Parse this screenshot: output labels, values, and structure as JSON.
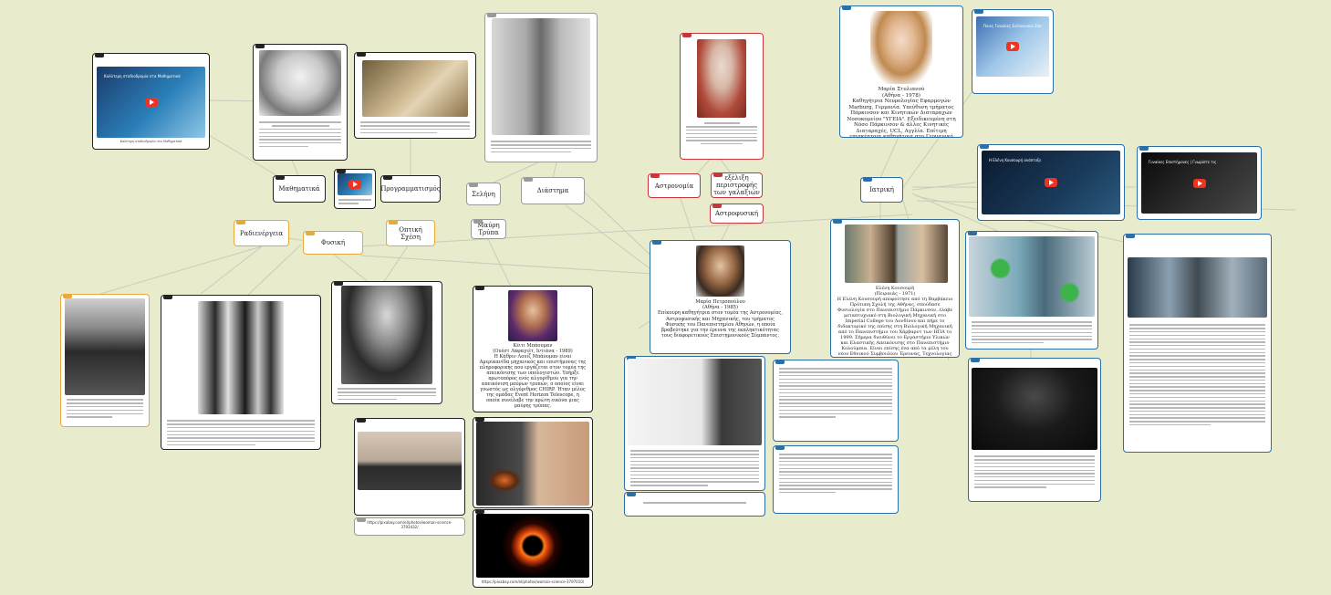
{
  "colors": {
    "background": "#e8ebcc",
    "black": "#222222",
    "blue": "#2a6fa8",
    "red": "#c7363c",
    "orange": "#e6a93a",
    "grey": "#9a9a9a",
    "link": "#c9ccbc"
  },
  "labels": {
    "mathimatika": "Μαθηματικά",
    "programmatismos": "Προγραμματισμός",
    "seliini": "Σελήνη",
    "diastima": "Διάστημα",
    "astronomia": "Αστρονομία",
    "galaxies": "εξέλιξη περιστροφής των γαλαξιών",
    "astrofysiki": "Αστροφυσική",
    "iatriki": "Ιατρική",
    "radienergeia": "Ραδιενέργεια",
    "fysiki": "Φυσική",
    "opt_sximi": "Οπτική Σχέση",
    "mavri_trypa": "Μαύρη Τρύπα"
  },
  "people": {
    "stylianou": {
      "name": "Μαρία Στυλιανού",
      "life": "(Αθήνα - 1978)",
      "text": "Καθηγήτρια Νευρολογίας Εφαρμογών Marburg, Γερμανία. Υπεύθυνη τμήματος Πάρκινσον και Κινητικών Διαταραχών Νοσοκομείου \"ΥΓΕΙΑ\". Εξειδικευμένη στη Νόσο Πάρκινσον & άλλες Κινητικές Διαταραχές, UCL, Αγγλία. Επίτιμη επισκέπτρια καθηγήτρια στο Γερμανικό Πανεπιστήμιο Κιέλου."
    },
    "petropoulou": {
      "name": "Μαρία Πετροπούλου",
      "life": "(Αθήνα - 1985)",
      "text": "Επίκουρη καθηγήτρια στον τομέα της Αστρονομίας, Αστροφυσικής και Μηχανικής, του τμήματος Φυσικής του Πανεπιστημίου Αθηνών, η οποία βραβεύτηκε για την έρευνα της εκπληκτικότητας τους διαφορετικούς Επιστημονικούς Σύμπαντος."
    },
    "bouman": {
      "name": "Κέιτι Μπάουμαν",
      "life": "(Ουέστ Λαφαγιέτ, Ιντιάνα - 1989)",
      "text": "Η Κάθριν Λουίζ Μπάουμαν είναι Αμερικανίδα μηχανικός και επιστήμονας της πληροφορικής που εργάζεται στον τομέα της απεικόνισης των υπολογιστών. Υπήρξε πρωτοπόρος ενός αλγορίθμου για την απεικόνιση μαύρων τρυπών, ο οποίος είναι γνωστός ως αλγόριθμος CHIRP. Ήταν μέλος της ομάδας Event Horizon Telescope, η οποία συνέλαβε την πρώτη εικόνα μιας μαύρης τρύπας."
    },
    "kousouri": {
      "name": "Ελένη Κουσουρή",
      "life": "(Πειραιάς - 1971)",
      "text": "Η Ελένη Κουσουρή αποφοίτησε από τη Βαρβάκειο Πρότυπη Σχολή της Αθήνας, σπούδασε Φυσιολογία στο Πανεπιστήμιο Πάρκινσον, έλαβε μεταπτυχιακό στη Βιολογική Μηχανική στο Imperial College του Λονδίνου και πήρε το διδακτορικό της επίσης στη Βιολογική Μηχανική από το Πανεπιστήμιο του Χάρβαρντ των ΗΠΑ το 1999. Σήμερα διευθύνει το Εργαστήριο Υλικών και Ελαστικής Απεικόνισης στο Πανεπιστήμιο Κολούμπια. Είναι επίσης ένα από τα μέλη του νέου Εθνικού Συμβουλίου Έρευνας, Τεχνολογίας και Καινοτομίας (ΕΣΕΤΕΚ) της Ελλάδας."
    }
  },
  "videos": {
    "v1": "Καλύτερη σταδιοδρομία στα Μαθηματικά",
    "v3": "Ποιες Γυναίκες Ενέπνευσαν Σπουδαίους",
    "v4": "Η Ελένη Κουσουρή ανάπτυξε",
    "v5": "Γυναίκες Επιστήμονες | Γνωρίστε τις"
  },
  "urls": {
    "u1": "https://pixabay.com/el/photos/woman-science-3793432/",
    "u2": "https://pixabay.com/el/photos/woman-science-3797010/"
  }
}
